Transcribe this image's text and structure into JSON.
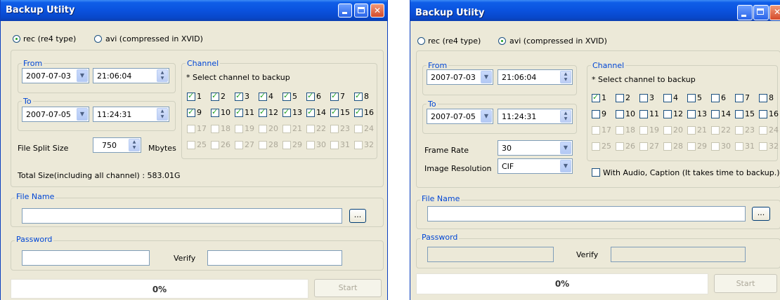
{
  "left": {
    "title": "Backup Utiity",
    "mode_rec": "rec (re4 type)",
    "mode_avi": "avi (compressed in XVID)",
    "from_label": "From",
    "from_date": "2007-07-03",
    "from_time": "21:06:04",
    "to_label": "To",
    "to_date": "2007-07-05",
    "to_time": "11:24:31",
    "channel_label": "Channel",
    "channel_hint": "* Select channel to backup",
    "channels": [
      "1",
      "2",
      "3",
      "4",
      "5",
      "6",
      "7",
      "8",
      "9",
      "10",
      "11",
      "12",
      "13",
      "14",
      "15",
      "16",
      "17",
      "18",
      "19",
      "20",
      "21",
      "22",
      "23",
      "24",
      "25",
      "26",
      "27",
      "28",
      "29",
      "30",
      "31",
      "32"
    ],
    "split_label": "File Split Size",
    "split_value": "750",
    "split_unit": "Mbytes",
    "total_size": "Total Size(including all channel) : 583.01G",
    "file_name_label": "File Name",
    "file_name_value": "",
    "browse_label": "...",
    "password_label": "Password",
    "verify_label": "Verify",
    "progress_text": "0%",
    "progress_value": 0,
    "start_label": "Start"
  },
  "right": {
    "title": "Backup Utiity",
    "mode_rec": "rec (re4 type)",
    "mode_avi": "avi (compressed in XVID)",
    "from_label": "From",
    "from_date": "2007-07-03",
    "from_time": "21:06:04",
    "to_label": "To",
    "to_date": "2007-07-05",
    "to_time": "11:24:31",
    "channel_label": "Channel",
    "channel_hint": "* Select channel to backup",
    "frame_rate_label": "Frame Rate",
    "frame_rate_value": "30",
    "resolution_label": "Image Resolution",
    "resolution_value": "CIF",
    "audio_label": "With Audio, Caption (It takes time to backup.)",
    "file_name_label": "File Name",
    "file_name_value": "",
    "browse_label": "...",
    "password_label": "Password",
    "verify_label": "Verify",
    "progress_text": "0%",
    "progress_value": 0,
    "start_label": "Start"
  },
  "colors": {
    "titlebar": "#0a52de",
    "group_label": "#0046d5",
    "check": "#21a121",
    "window_bg": "#ece9d8"
  }
}
